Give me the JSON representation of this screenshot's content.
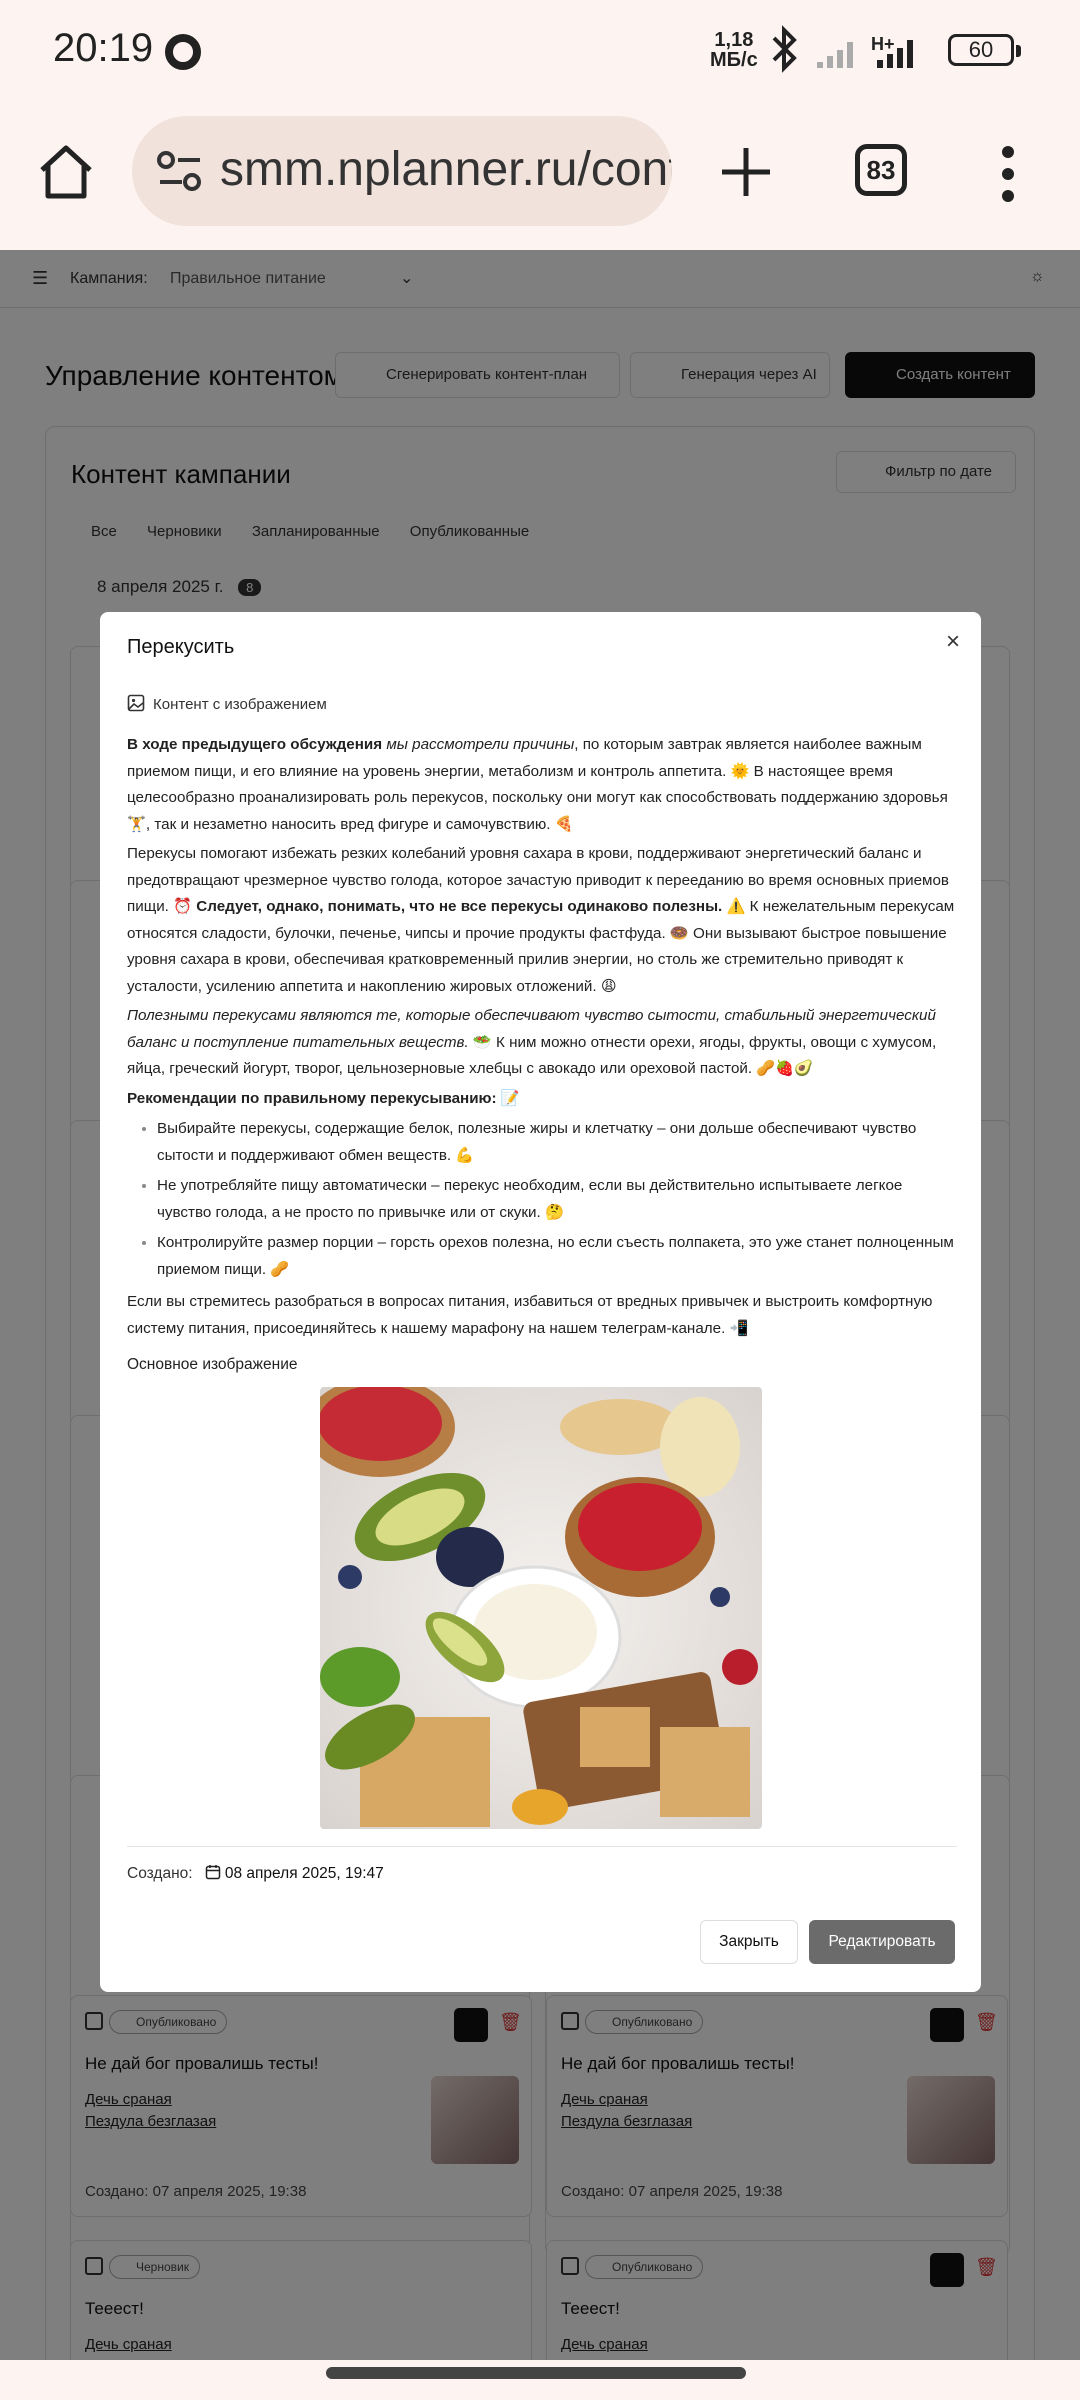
{
  "status_bar": {
    "time": "20:19",
    "speed_value": "1,18",
    "speed_unit": "МБ/с",
    "network": "H+",
    "battery": "60"
  },
  "browser": {
    "url": "smm.nplanner.ru/cont",
    "tabs_count": "83"
  },
  "page": {
    "topnav": {
      "campaign_label": "Кампания:",
      "campaign_value": "Правильное питание"
    },
    "title": "Управление контентом",
    "buttons": {
      "generate_plan": "Сгенерировать контент-план",
      "ai_generate": "Генерация через AI",
      "create": "Создать контент"
    },
    "panel_title": "Контент кампании",
    "filter_label": "Фильтр по дате",
    "tabs": [
      "Все",
      "Черновики",
      "Запланированные",
      "Опубликованные"
    ],
    "date_group": "8 апреля 2025 г.",
    "date_group_count": "8",
    "cards": [
      {
        "badge": "Опубликовано",
        "title": "Не дай бог провалишь тесты!",
        "link1": "Дечь сраная",
        "link2": "Пездула безглазая",
        "created_label": "Создано:",
        "created": "07 апреля 2025, 19:38"
      },
      {
        "badge": "Опубликовано",
        "title": "Не дай бог провалишь тесты!",
        "link1": "Дечь сраная",
        "link2": "Пездула безглазая",
        "created_label": "Создано:",
        "created": "07 апреля 2025, 19:38"
      },
      {
        "badge": "Черновик",
        "title": "Тееест!",
        "link1": "Дечь сраная"
      },
      {
        "badge": "Опубликовано",
        "title": "Тееест!",
        "link1": "Дечь сраная"
      }
    ]
  },
  "modal": {
    "title": "Перекусить",
    "content_type": "Контент с изображением",
    "body": {
      "p1_bold": "В ходе предыдущего обсуждения",
      "p1_italic": "мы рассмотрели причины",
      "p1_rest": ", по которым завтрак является наиболее важным приемом пищи, и его влияние на уровень энергии, метаболизм и контроль аппетита. 🌞 В настоящее время целесообразно проанализировать роль перекусов, поскольку они могут как способствовать поддержанию здоровья 🏋️, так и незаметно наносить вред фигуре и самочувствию. 🍕",
      "p2_a": "Перекусы помогают избежать резких колебаний уровня сахара в крови, поддерживают энергетический баланс и предотвращают чрезмерное чувство голода, которое зачастую приводит к перееданию во время основных приемов пищи. ⏰",
      "p2_bold": "Следует, однако, понимать, что не все перекусы одинаково полезны.",
      "p2_b": "⚠️ К нежелательным перекусам относятся сладости, булочки, печенье, чипсы и прочие продукты фастфуда. 🍩 Они вызывают быстрое повышение уровня сахара в крови, обеспечивая кратковременный прилив энергии, но столь же стремительно приводят к усталости, усилению аппетита и накоплению жировых отложений. 😩",
      "p3_italic": "Полезными перекусами являются те, которые обеспечивают чувство сытости, стабильный энергетический баланс и поступление питательных веществ.",
      "p3_rest": "🥗 К ним можно отнести орехи, ягоды, фрукты, овощи с хумусом, яйца, греческий йогурт, творог, цельнозерновые хлебцы с авокадо или ореховой пастой. 🥜🍓🥑",
      "p4_bold": "Рекомендации по правильному перекусыванию:",
      "p4_emoji": "📝",
      "list": [
        "Выбирайте перекусы, содержащие белок, полезные жиры и клетчатку – они дольше обеспечивают чувство сытости и поддерживают обмен веществ. 💪",
        "Не употребляйте пищу автоматически – перекус необходим, если вы действительно испытываете легкое чувство голода, а не просто по привычке или от скуки. 🤔",
        "Контролируйте размер порции – горсть орехов полезна, но если съесть полпакета, это уже станет полноценным приемом пищи. 🥜"
      ],
      "p5": "Если вы стремитесь разобраться в вопросах питания, избавиться от вредных привычек и выстроить комфортную систему питания, присоединяйтесь к нашему марафону на нашем телеграм-канале. 📲"
    },
    "image_label": "Основное изображение",
    "created_label": "Создано:",
    "created_value": "08 апреля 2025, 19:47",
    "close_label": "Закрыть",
    "edit_label": "Редактировать"
  }
}
